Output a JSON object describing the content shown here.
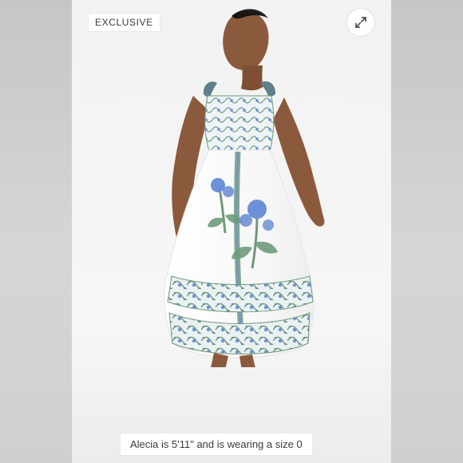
{
  "badge": {
    "label": "EXCLUSIVE"
  },
  "expand_button": {
    "icon": "expand-arrows-icon"
  },
  "caption": {
    "text": "Alecia is 5'11\" and is wearing a size 0"
  },
  "colors": {
    "dress_white": "#ffffff",
    "print_blue": "#6d90d6",
    "print_green": "#6f9a7b",
    "print_slate": "#5f7f8a",
    "skin": "#8b5a3c",
    "sandals": "#d8c29a"
  }
}
